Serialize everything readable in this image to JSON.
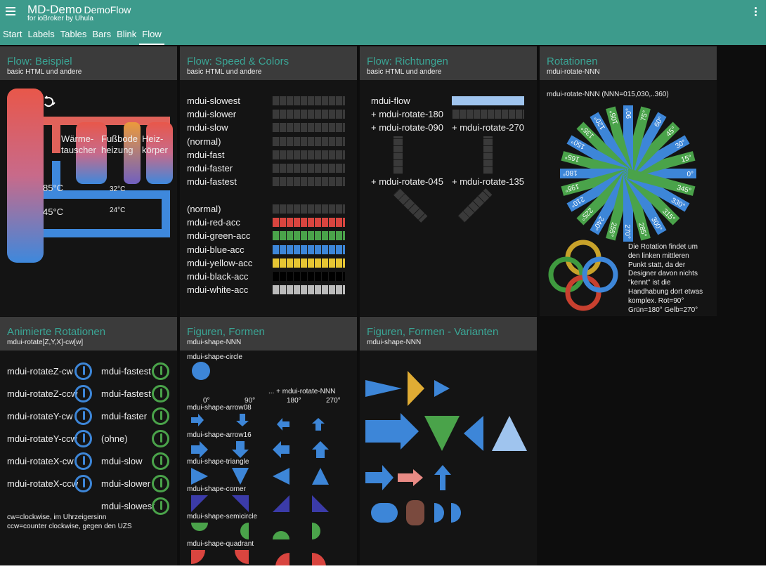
{
  "header": {
    "title": "MD-Demo",
    "title_sub": "DemoFlow",
    "subtitle": "for ioBroker by Uhula"
  },
  "tabs": [
    "Start",
    "Labels",
    "Tables",
    "Bars",
    "Blink",
    "Flow"
  ],
  "active_tab": "Flow",
  "colors": {
    "accent": "#3d9b8c",
    "card_title": "#3aa595",
    "card_head": "#3b3b3b",
    "blue": "#3d86d8",
    "green": "#4aa34a",
    "red": "#d9453f",
    "yellow": "#e6c533",
    "orange": "#e39a3a"
  },
  "card_flow": {
    "title": "Flow: Beispiel",
    "sub": "basic HTML und andere",
    "label_waerme": "Wärme-",
    "label_tauscher": "tauscher",
    "label_fussbode": "Fußbode",
    "label_heizung": "heizung",
    "label_heiz": "Heiz-",
    "label_koerper": "körper",
    "temp_85": "85°C",
    "temp_45": "45°C",
    "temp_32": "32°C",
    "temp_24": "24°C"
  },
  "card_speed": {
    "title": "Flow: Speed & Colors",
    "sub": "basic HTML und andere",
    "speeds": [
      "mdui-slowest",
      "mdui-slower",
      "mdui-slow",
      "(normal)",
      "mdui-fast",
      "mdui-faster",
      "mdui-fastest"
    ],
    "colors": [
      "(normal)",
      "mdui-red-acc",
      "mdui-green-acc",
      "mdui-blue-acc",
      "mdui-yellow-acc",
      "mdui-black-acc",
      "mdui-white-acc"
    ]
  },
  "card_dir": {
    "title": "Flow: Richtungen",
    "sub": "basic HTML und andere",
    "l1": "mdui-flow",
    "l2": "+ mdui-rotate-180",
    "l3": "+ mdui-rotate-090",
    "l4": "+ mdui-rotate-270",
    "l5": "+ mdui-rotate-045",
    "l6": "+ mdui-rotate-135"
  },
  "card_rot": {
    "title": "Rotationen",
    "sub": "mdui-rotate-NNN",
    "caption": "mdui-rotate-NNN (NNN=015,030,..360)",
    "angles": [
      "0°",
      "15°",
      "30°",
      "45°",
      "60°",
      "75°",
      "90°",
      "105°",
      "120°",
      "135°",
      "150°",
      "165°",
      "180°",
      "195°",
      "210°",
      "225°",
      "240°",
      "255°",
      "270°",
      "285°",
      "300°",
      "315°",
      "330°",
      "345°"
    ],
    "note": [
      "Die Rotation findet um",
      "den linken mittleren",
      "Punkt statt, da der",
      "Designer davon nichts",
      "\"kennt\" ist die",
      "Handhabung dort etwas",
      "komplex. Rot=90°",
      "Grün=180° Gelb=270°"
    ]
  },
  "card_anim": {
    "title": "Animierte Rotationen",
    "sub": "mdui-rotate[Z,Y,X]-cw[w]",
    "left": [
      "mdui-rotateZ-cw",
      "mdui-rotateZ-ccw",
      "mdui-rotateY-cw",
      "mdui-rotateY-ccw",
      "mdui-rotateX-cw",
      "mdui-rotateX-ccw"
    ],
    "right": [
      "mdui-fastest",
      "mdui-fastest",
      "mdui-faster",
      "(ohne)",
      "mdui-slow",
      "mdui-slower",
      "mdui-slowest"
    ],
    "foot1": "cw=clockwise, im Uhrzeigersinn",
    "foot2": "ccw=counter clockwise, gegen den UZS"
  },
  "card_shapes": {
    "title": "Figuren, Formen",
    "sub": "mdui-shape-NNN",
    "circle": "mdui-shape-circle",
    "rotate_note": "... + mdui-rotate-NNN",
    "deg": [
      "0°",
      "90°",
      "180°",
      "270°"
    ],
    "names": [
      "mdui-shape-arrow08",
      "mdui-shape-arrow16",
      "mdui-shape-triangle",
      "mdui-shape-corner",
      "mdui-shape-semicircle",
      "mdui-shape-quadrant"
    ]
  },
  "card_variants": {
    "title": "Figuren, Formen - Varianten",
    "sub": "mdui-shape-NNN"
  }
}
